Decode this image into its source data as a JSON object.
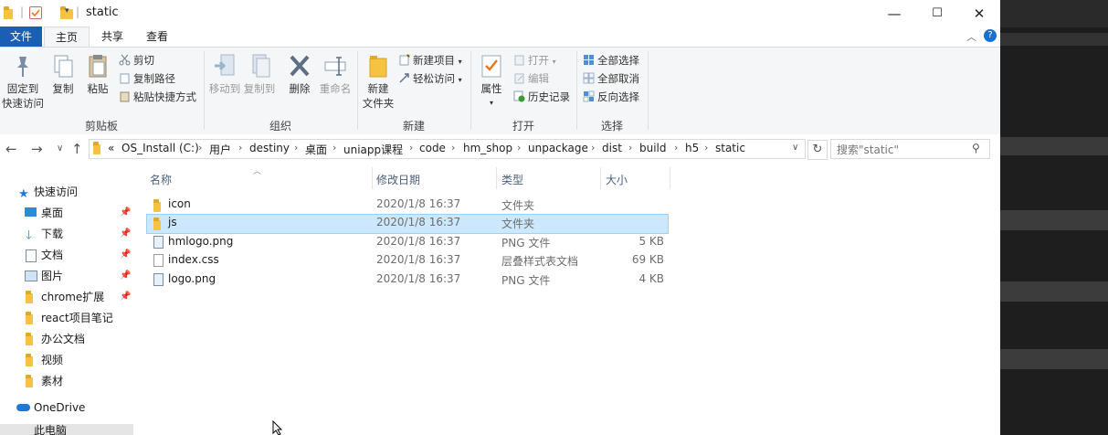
{
  "window": {
    "title": "static",
    "minimize_glyph": "—",
    "maximize_glyph": "☐",
    "close_glyph": "✕"
  },
  "ribbon_tabs": [
    "文件",
    "主页",
    "共享",
    "查看"
  ],
  "ribbon": {
    "clipboard": {
      "group_label": "剪贴板",
      "pin_line1": "固定到",
      "pin_line2": "快速访问",
      "copy": "复制",
      "paste": "粘贴",
      "cut": "剪切",
      "copy_path": "复制路径",
      "paste_shortcut": "粘贴快捷方式"
    },
    "organize": {
      "group_label": "组织",
      "move_to": "移动到",
      "copy_to": "复制到",
      "delete": "删除",
      "rename": "重命名"
    },
    "new": {
      "group_label": "新建",
      "new_folder_line1": "新建",
      "new_folder_line2": "文件夹",
      "new_item": "新建项目",
      "easy_access": "轻松访问"
    },
    "open": {
      "group_label": "打开",
      "properties": "属性",
      "open": "打开",
      "edit": "编辑",
      "history": "历史记录"
    },
    "select": {
      "group_label": "选择",
      "select_all": "全部选择",
      "select_none": "全部取消",
      "invert": "反向选择"
    }
  },
  "address": {
    "prefix": "«",
    "crumbs": [
      "OS_Install (C:)",
      "用户",
      "destiny",
      "桌面",
      "uniapp课程",
      "code",
      "hm_shop",
      "unpackage",
      "dist",
      "build",
      "h5",
      "static"
    ]
  },
  "search": {
    "placeholder": "搜索\"static\""
  },
  "nav_pane": {
    "quick_access": "快速访问",
    "items": [
      {
        "label": "桌面",
        "icon": "desktop-icon",
        "pinned": true
      },
      {
        "label": "下载",
        "icon": "download-icon",
        "pinned": true
      },
      {
        "label": "文档",
        "icon": "document-icon",
        "pinned": true
      },
      {
        "label": "图片",
        "icon": "pictures-icon",
        "pinned": true
      },
      {
        "label": "chrome扩展",
        "icon": "folder-icon",
        "pinned": true
      },
      {
        "label": "react项目笔记",
        "icon": "folder-icon",
        "pinned": false
      },
      {
        "label": "办公文档",
        "icon": "folder-icon",
        "pinned": false
      },
      {
        "label": "视频",
        "icon": "folder-icon",
        "pinned": false
      },
      {
        "label": "素材",
        "icon": "folder-icon",
        "pinned": false
      }
    ],
    "onedrive": "OneDrive",
    "this_pc": "此电脑"
  },
  "file_list": {
    "columns": [
      "名称",
      "修改日期",
      "类型",
      "大小"
    ],
    "rows": [
      {
        "name": "icon",
        "date": "2020/1/8 16:37",
        "type": "文件夹",
        "size": "",
        "icon": "folder-icon",
        "selected": false
      },
      {
        "name": "js",
        "date": "2020/1/8 16:37",
        "type": "文件夹",
        "size": "",
        "icon": "folder-icon",
        "selected": true
      },
      {
        "name": "hmlogo.png",
        "date": "2020/1/8 16:37",
        "type": "PNG 文件",
        "size": "5 KB",
        "icon": "image-file-icon",
        "selected": false
      },
      {
        "name": "index.css",
        "date": "2020/1/8 16:37",
        "type": "层叠样式表文档",
        "size": "69 KB",
        "icon": "css-file-icon",
        "selected": false
      },
      {
        "name": "logo.png",
        "date": "2020/1/8 16:37",
        "type": "PNG 文件",
        "size": "4 KB",
        "icon": "image-file-icon",
        "selected": false
      }
    ]
  },
  "colors": {
    "file_tab": "#1a5fb4",
    "selection": "#cce8ff",
    "selection_border": "#99d1ff",
    "folder": "#f5c242"
  }
}
